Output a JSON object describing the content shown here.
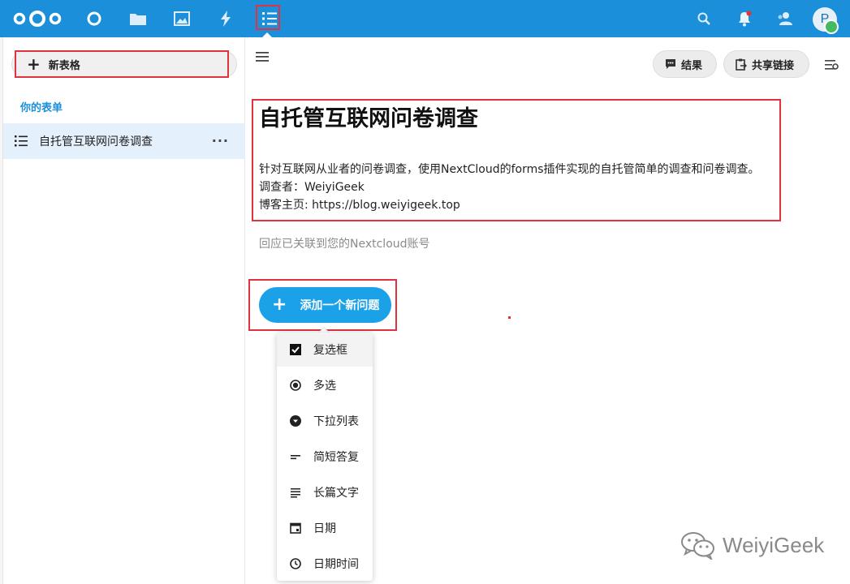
{
  "header": {
    "nav": [
      {
        "name": "dashboard-icon"
      },
      {
        "name": "files-icon"
      },
      {
        "name": "photos-icon"
      },
      {
        "name": "activity-icon"
      },
      {
        "name": "forms-icon",
        "active": true
      }
    ],
    "right_icons": [
      "search-icon",
      "notifications-icon",
      "contacts-icon"
    ],
    "avatar_initial": "P",
    "accent_color": "#1b8fd9"
  },
  "sidebar": {
    "new_form_label": "新表格",
    "section_title": "你的表单",
    "forms": [
      {
        "label": "自托管互联网问卷调查",
        "more": "···"
      }
    ]
  },
  "toolbar": {
    "results_label": "结果",
    "share_link_label": "共享链接"
  },
  "form": {
    "title": "自托管互联网问卷调查",
    "description_lines": [
      "针对互联网从业者的问卷调查，使用NextCloud的forms插件实现的自托管简单的调查和问卷调查。",
      "调查者：WeiyiGeek",
      "博客主页: https://blog.weiyigeek.top"
    ],
    "account_note": "回应已关联到您的Nextcloud账号"
  },
  "add_question": {
    "label": "添加一个新问题",
    "menu": [
      {
        "label": "复选框",
        "icon": "checkbox-icon",
        "selected": true
      },
      {
        "label": "多选",
        "icon": "radio-icon"
      },
      {
        "label": "下拉列表",
        "icon": "dropdown-icon"
      },
      {
        "label": "简短答复",
        "icon": "short-answer-icon"
      },
      {
        "label": "长篇文字",
        "icon": "long-text-icon"
      },
      {
        "label": "日期",
        "icon": "calendar-icon"
      },
      {
        "label": "日期时间",
        "icon": "clock-icon"
      }
    ]
  },
  "watermark": {
    "text": "WeiyiGeek"
  }
}
